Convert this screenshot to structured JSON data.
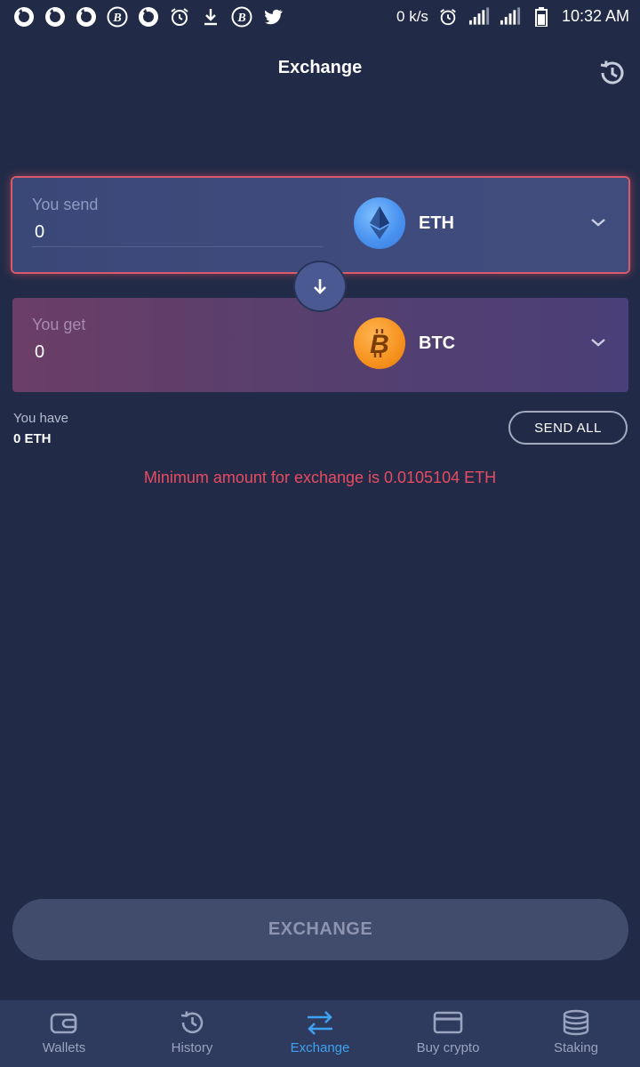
{
  "status_bar": {
    "left_icons": [
      "opera-icon",
      "opera-icon",
      "opera-icon",
      "bitcoin-circle-icon",
      "opera-icon",
      "alarm-icon",
      "download-icon",
      "bitcoin-circle-icon",
      "twitter-icon"
    ],
    "net_speed": "0 k/s",
    "time": "10:32 AM"
  },
  "header": {
    "title": "Exchange"
  },
  "send_card": {
    "label": "You send",
    "amount": "0",
    "coin": "ETH"
  },
  "get_card": {
    "label": "You get",
    "amount": "0",
    "coin": "BTC"
  },
  "balance": {
    "label": "You have",
    "value": "0 ETH",
    "send_all_label": "SEND ALL"
  },
  "error_message": "Minimum amount for exchange is 0.0105104 ETH",
  "exchange_button": {
    "label": "EXCHANGE"
  },
  "bottom_nav": {
    "items": [
      {
        "label": "Wallets",
        "icon": "wallet-icon",
        "active": false
      },
      {
        "label": "History",
        "icon": "history-icon",
        "active": false
      },
      {
        "label": "Exchange",
        "icon": "exchange-arrows-icon",
        "active": true
      },
      {
        "label": "Buy crypto",
        "icon": "credit-card-icon",
        "active": false
      },
      {
        "label": "Staking",
        "icon": "coins-stack-icon",
        "active": false
      }
    ]
  },
  "colors": {
    "background": "#212b47",
    "error": "#e94b62",
    "active_tab": "#3ea2f0",
    "send_card_border": "#d95a6b"
  }
}
